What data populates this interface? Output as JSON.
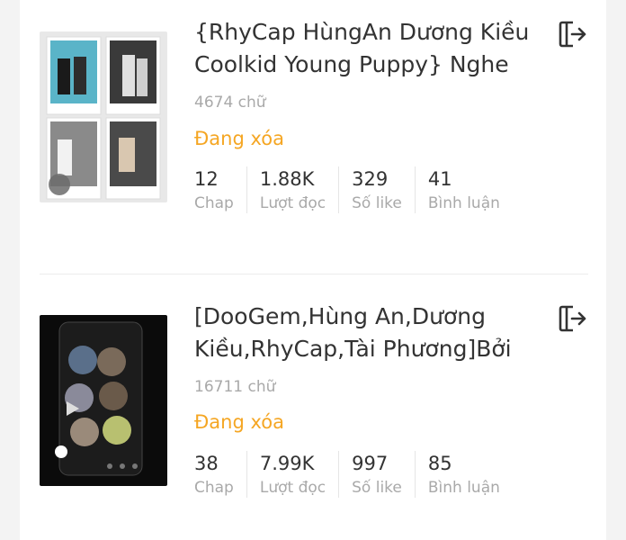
{
  "stories": [
    {
      "title": "{RhyCap HùngAn Dương Kiều\nCoolkid Young Puppy} Nghe",
      "words": "4674 chữ",
      "status": "Đang xóa",
      "stats": [
        {
          "value": "12",
          "label": "Chap"
        },
        {
          "value": "1.88K",
          "label": "Lượt đọc"
        },
        {
          "value": "329",
          "label": "Số like"
        },
        {
          "value": "41",
          "label": "Bình luận"
        }
      ],
      "action_icon": "exit-icon"
    },
    {
      "title": "[DooGem,Hùng An,Dương\nKiều,RhyCap,Tài Phương]Bởi",
      "words": "16711 chữ",
      "status": "Đang xóa",
      "stats": [
        {
          "value": "38",
          "label": "Chap"
        },
        {
          "value": "7.99K",
          "label": "Lượt đọc"
        },
        {
          "value": "997",
          "label": "Số like"
        },
        {
          "value": "85",
          "label": "Bình luận"
        }
      ],
      "action_icon": "exit-icon"
    }
  ],
  "colors": {
    "status": "#f5a623",
    "title": "#333333",
    "muted": "#a9a9a9"
  }
}
